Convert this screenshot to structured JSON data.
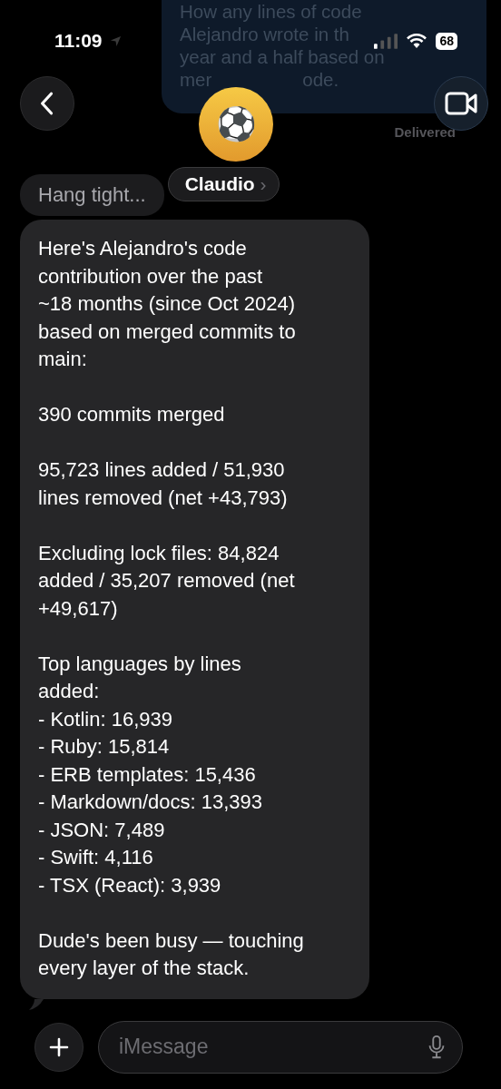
{
  "status_bar": {
    "time": "11:09",
    "battery": "68"
  },
  "sent_message": {
    "lines": [
      [
        "How any lines of code"
      ],
      [
        "Alejandro wrote in th"
      ],
      [
        "year and a half based on"
      ],
      [
        "mer",
        "ode."
      ]
    ],
    "status": "Delivered"
  },
  "contact": {
    "name": "Claudio",
    "avatar_emoji": "⚽",
    "chevron": "›"
  },
  "typing_bubble": {
    "text": "Hang tight..."
  },
  "received_message": {
    "paragraphs": [
      "Here's Alejandro's code\ncontribution over the past\n~18 months (since Oct 2024)\nbased on merged commits to\nmain:",
      "390 commits merged",
      "95,723 lines added / 51,930\nlines removed (net +43,793)",
      "Excluding lock files: 84,824\nadded / 35,207 removed (net\n+49,617)",
      "Top languages by lines\nadded:\n- Kotlin: 16,939\n- Ruby: 15,814\n- ERB templates: 15,436\n- Markdown/docs: 13,393\n- JSON: 7,489\n- Swift: 4,116\n- TSX (React): 3,939",
      "Dude's been busy — touching\nevery layer of the stack."
    ]
  },
  "composer": {
    "placeholder": "iMessage"
  }
}
